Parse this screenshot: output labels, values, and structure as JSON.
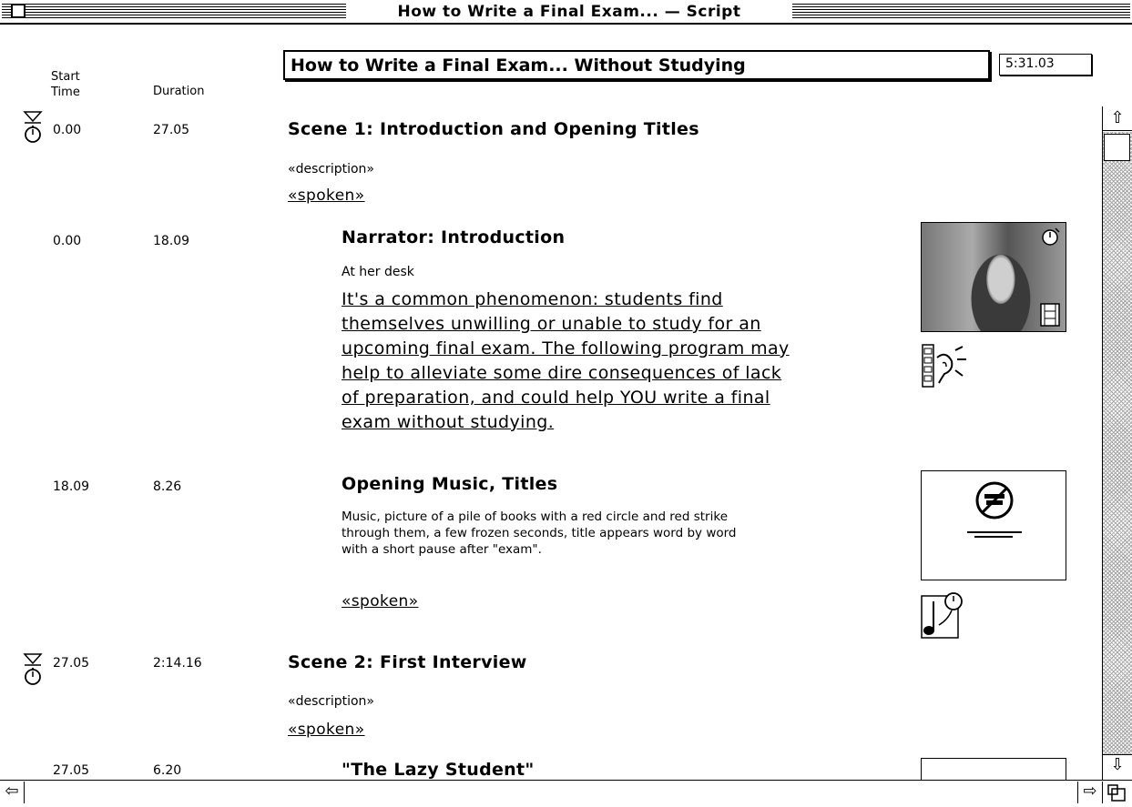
{
  "window": {
    "title": "How to Write a Final Exam... — Script"
  },
  "header": {
    "start_time_label": "Start\nTime",
    "start_line1": "Start",
    "start_line2": "Time",
    "duration_label": "Duration",
    "script_title": "How to Write a Final Exam... Without Studying",
    "total_time": "5:31.03"
  },
  "scenes": [
    {
      "start": "0.00",
      "duration": "27.05",
      "title": "Scene 1: Introduction and Opening Titles",
      "description": "«description»",
      "spoken": "«spoken»"
    },
    {
      "start": "27.05",
      "duration": "2:14.16",
      "title": "Scene 2: First Interview",
      "description": "«description»",
      "spoken": "«spoken»"
    }
  ],
  "shots": [
    {
      "start": "0.00",
      "duration": "18.09",
      "title": "Narrator: Introduction",
      "description": "At her desk",
      "spoken_lines": [
        "It's a common phenomenon: students find",
        "themselves unwilling or unable to study for an",
        "upcoming final exam.  The following program may",
        "help to alleviate some dire consequences of lack",
        "of preparation, and could help YOU write a final",
        "exam without studying."
      ]
    },
    {
      "start": "18.09",
      "duration": "8.26",
      "title": "Opening Music, Titles",
      "description_lines": [
        "Music, picture of a pile of books with a red circle and red strike",
        "through them, a few frozen seconds, title appears word by word",
        "with a short pause after \"exam\"."
      ],
      "spoken": "«spoken»"
    },
    {
      "start": "27.05",
      "duration": "6.20",
      "title": "\"The Lazy Student\""
    }
  ],
  "icons": {
    "stopwatch": "stopwatch-icon",
    "film": "film-icon",
    "sound": "sound-icon",
    "music": "music-note-icon",
    "scroll_up": "scroll-up-arrow-icon",
    "scroll_down": "scroll-down-arrow-icon",
    "scroll_left": "scroll-left-arrow-icon",
    "scroll_right": "scroll-right-arrow-icon",
    "grow": "grow-box-icon"
  }
}
